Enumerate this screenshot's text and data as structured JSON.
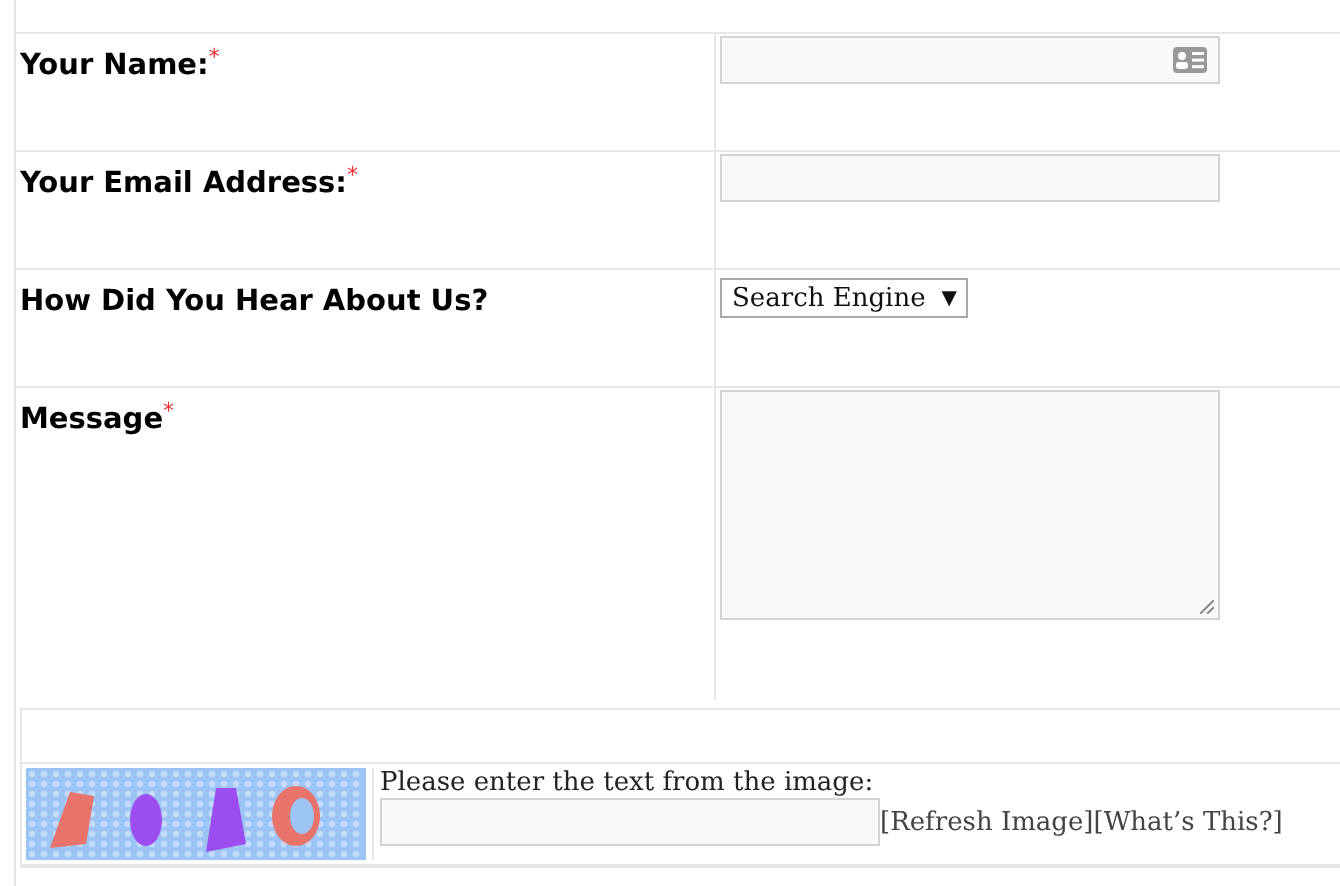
{
  "fields": [
    {
      "label": "Your Name:",
      "required_mark": "*",
      "kind": "text",
      "card_icon": true
    },
    {
      "label": "Your Email Address:",
      "required_mark": "*",
      "kind": "text",
      "card_icon": false
    },
    {
      "label": "How Did You Hear About Us?",
      "kind": "select",
      "value": "Search Engine",
      "caret": "▼"
    },
    {
      "label": "Message",
      "required_mark": "*",
      "kind": "textarea"
    }
  ],
  "captcha": {
    "prompt": "Please enter the text from the image:",
    "links": [
      "[Refresh Image]",
      "[What’s This?]"
    ]
  }
}
